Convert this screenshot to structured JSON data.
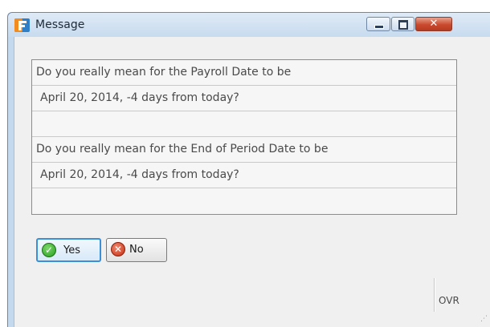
{
  "window": {
    "title": "Message"
  },
  "message": {
    "lines": [
      "Do you really mean for the Payroll Date to be",
      "April 20, 2014, -4 days from today?",
      "",
      "Do you really mean for the End of Period Date to be",
      "April 20, 2014, -4 days from today?",
      ""
    ]
  },
  "buttons": {
    "yes_label": "Yes",
    "no_label": "No"
  },
  "status": {
    "mode": "OVR"
  },
  "colors": {
    "title_bar": "#c7dbef",
    "close_button": "#c94a2e",
    "yes_focus_border": "#3a8fd6"
  },
  "icons": {
    "app": "app-logo-icon",
    "yes": "checkmark-icon",
    "no": "x-icon"
  }
}
